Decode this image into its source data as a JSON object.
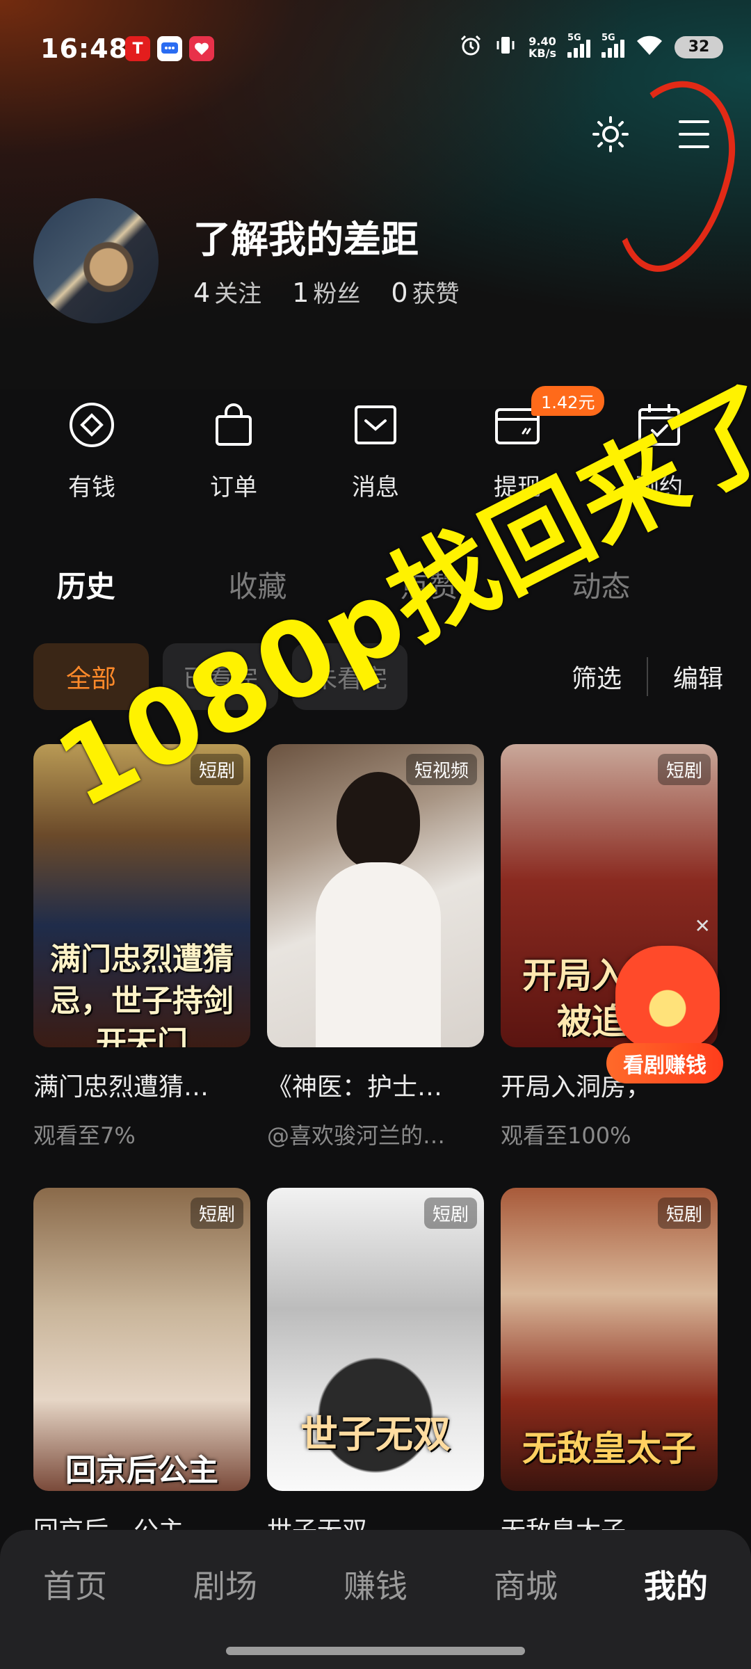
{
  "status_bar": {
    "time": "16:48",
    "net_speed_value": "9.40",
    "net_speed_unit": "KB/s",
    "signal_1": "5G",
    "signal_2": "5G",
    "battery": "32"
  },
  "profile": {
    "nickname": "了解我的差距",
    "following_count": "4",
    "following_label": "关注",
    "fans_count": "1",
    "fans_label": "粉丝",
    "likes_count": "0",
    "likes_label": "获赞"
  },
  "quick_actions": [
    {
      "label": "有钱",
      "icon": "coin-icon"
    },
    {
      "label": "订单",
      "icon": "shopping-bag-icon"
    },
    {
      "label": "消息",
      "icon": "message-icon"
    },
    {
      "label": "提现",
      "icon": "wallet-icon",
      "badge": "1.42元"
    },
    {
      "label": "预约",
      "icon": "calendar-check-icon"
    }
  ],
  "tabs": [
    "历史",
    "收藏",
    "点赞",
    "动态"
  ],
  "filters": {
    "chips": [
      "全部",
      "已看完",
      "未看完"
    ],
    "filter_label": "筛选",
    "edit_label": "编辑"
  },
  "cards": [
    {
      "title": "满门忠烈遭猜…",
      "subtitle": "观看至7%",
      "tag": "短剧",
      "poster_text": "满门忠烈遭猜忌，世子持剑开天门"
    },
    {
      "title": "《神医：护士…",
      "subtitle": "@喜欢骏河兰的…",
      "tag": "短视频",
      "poster_text": ""
    },
    {
      "title": "开局入洞房，",
      "subtitle": "观看至100%",
      "tag": "短剧",
      "poster_text": "开局入洞房被追杀"
    },
    {
      "title": "回京后，公主…",
      "subtitle": "",
      "tag": "短剧",
      "poster_text": "回京后公主"
    },
    {
      "title": "世子无双",
      "subtitle": "",
      "tag": "短剧",
      "poster_text": "世子无双"
    },
    {
      "title": "无敌皇太子",
      "subtitle": "",
      "tag": "短剧",
      "poster_text": "无敌皇太子"
    }
  ],
  "promo": {
    "label": "看剧赚钱"
  },
  "overlay_text": "1080p找回来了",
  "bottom_nav": [
    "首页",
    "剧场",
    "赚钱",
    "商城",
    "我的"
  ],
  "colors": {
    "accent": "#ff8a2a",
    "overlay": "#fff200",
    "scribble": "#e22a16"
  }
}
